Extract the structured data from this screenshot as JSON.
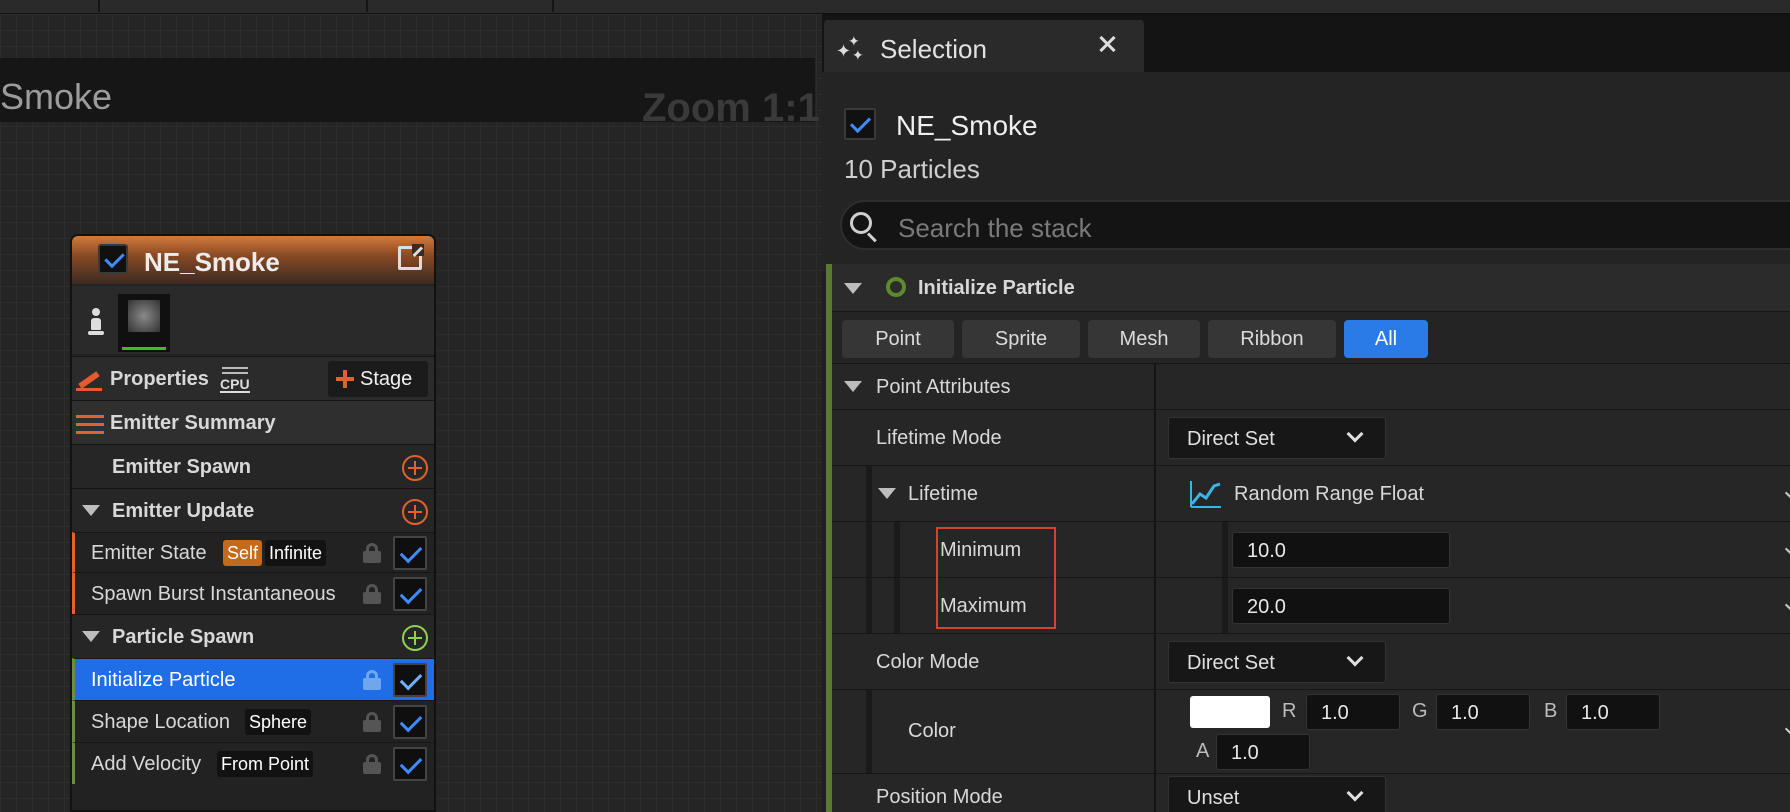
{
  "graph": {
    "title": "Smoke",
    "zoom": "Zoom 1:1"
  },
  "node": {
    "name": "NE_Smoke",
    "properties_label": "Properties",
    "cpu_label": "CPU",
    "stage_label": "Stage",
    "summary_label": "Emitter Summary",
    "sections": {
      "emitter_spawn": "Emitter Spawn",
      "emitter_update": "Emitter Update",
      "particle_spawn": "Particle Spawn"
    },
    "modules": {
      "emitter_state": {
        "label": "Emitter State",
        "tag1": "Self",
        "tag2": "Infinite"
      },
      "spawn_burst": {
        "label": "Spawn Burst Instantaneous"
      },
      "initialize_particle": {
        "label": "Initialize Particle"
      },
      "shape_location": {
        "label": "Shape Location",
        "tag": "Sphere"
      },
      "add_velocity": {
        "label": "Add Velocity",
        "tag": "From Point"
      }
    }
  },
  "panel": {
    "tab_title": "Selection",
    "emitter_name": "NE_Smoke",
    "particle_count": "10 Particles",
    "search_placeholder": "Search the stack",
    "section_title": "Initialize Particle",
    "filter_tabs": [
      "Point",
      "Sprite",
      "Mesh",
      "Ribbon",
      "All"
    ],
    "active_filter": "All",
    "group_title": "Point Attributes",
    "lifetime_mode": {
      "label": "Lifetime Mode",
      "value": "Direct Set"
    },
    "lifetime": {
      "label": "Lifetime",
      "value": "Random Range Float"
    },
    "minimum": {
      "label": "Minimum",
      "value": "10.0"
    },
    "maximum": {
      "label": "Maximum",
      "value": "20.0"
    },
    "color_mode": {
      "label": "Color Mode",
      "value": "Direct Set"
    },
    "color": {
      "label": "Color",
      "swatch": "#ffffff",
      "r_label": "R",
      "r": "1.0",
      "g_label": "G",
      "g": "1.0",
      "b_label": "B",
      "b": "1.0",
      "a_label": "A",
      "a": "1.0"
    },
    "position_mode": {
      "label": "Position Mode",
      "value": "Unset"
    }
  },
  "colors": {
    "accent_blue": "#1f6ee8",
    "emitter_orange": "#e0622e",
    "spawn_green": "#8fd14f",
    "highlight_red": "#d4432c"
  }
}
